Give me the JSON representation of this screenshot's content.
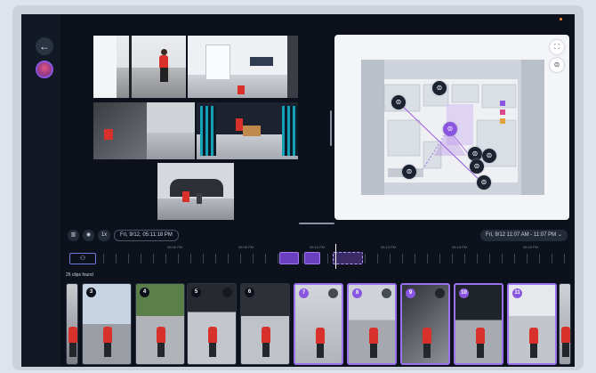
{
  "controls": {
    "speed": "1x",
    "current_time": "Fri, 9/12, 05:11:18 PM",
    "time_range": "Fri, 9/12 11:07 AM - 11:07 PM"
  },
  "timeline": {
    "tick_labels": [
      "05:06 PM",
      "05:08 PM",
      "05:10 PM",
      "05:13 PM",
      "05:15 PM",
      "05:20 PM",
      "05:23 PM"
    ]
  },
  "clips": {
    "count_label": "26 clips found",
    "items": [
      {
        "num": "",
        "selected": false
      },
      {
        "num": "3",
        "selected": false
      },
      {
        "num": "4",
        "selected": false
      },
      {
        "num": "5",
        "selected": false
      },
      {
        "num": "6",
        "selected": false
      },
      {
        "num": "7",
        "selected": true
      },
      {
        "num": "8",
        "selected": true
      },
      {
        "num": "9",
        "selected": true
      },
      {
        "num": "10",
        "selected": true
      },
      {
        "num": "11",
        "selected": true
      },
      {
        "num": "",
        "selected": false
      }
    ]
  },
  "colors": {
    "accent": "#8a55e0",
    "background": "#0c111b",
    "map_path": "#9a5de0",
    "person_jacket": "#d8312c"
  },
  "icons": {
    "back": "arrow-left-icon",
    "expand": "fullscreen-icon",
    "camera": "camera-icon",
    "person": "person-icon",
    "calendar": "calendar-icon",
    "view": "eye-icon",
    "layout": "grid-icon"
  }
}
